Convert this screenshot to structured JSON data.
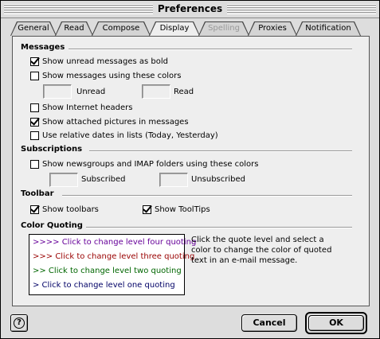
{
  "window": {
    "title": "Preferences"
  },
  "tabs": [
    {
      "label": "General",
      "active": false,
      "disabled": false
    },
    {
      "label": "Read",
      "active": false,
      "disabled": false
    },
    {
      "label": "Compose",
      "active": false,
      "disabled": false
    },
    {
      "label": "Display",
      "active": true,
      "disabled": false
    },
    {
      "label": "Spelling",
      "active": false,
      "disabled": true
    },
    {
      "label": "Proxies",
      "active": false,
      "disabled": false
    },
    {
      "label": "Notification",
      "active": false,
      "disabled": false
    }
  ],
  "messages": {
    "title": "Messages",
    "show_unread_bold": {
      "label": "Show unread messages as bold",
      "checked": true
    },
    "use_colors": {
      "label": "Show messages using these colors",
      "checked": false
    },
    "unread_label": "Unread",
    "read_label": "Read",
    "show_internet_headers": {
      "label": "Show Internet headers",
      "checked": false
    },
    "show_attached_pictures": {
      "label": "Show attached pictures in messages",
      "checked": true
    },
    "relative_dates": {
      "label": "Use relative dates in lists (Today, Yesterday)",
      "checked": false
    }
  },
  "subscriptions": {
    "title": "Subscriptions",
    "use_colors": {
      "label": "Show newsgroups and IMAP folders using these colors",
      "checked": false
    },
    "subscribed_label": "Subscribed",
    "unsubscribed_label": "Unsubscribed"
  },
  "toolbar": {
    "title": "Toolbar",
    "show_toolbars": {
      "label": "Show toolbars",
      "checked": true
    },
    "show_tooltips": {
      "label": "Show ToolTips",
      "checked": true
    }
  },
  "color_quoting": {
    "title": "Color Quoting",
    "levels": [
      {
        "text": ">>>> Click to change level four quoting",
        "color": "#660099"
      },
      {
        "text": ">>> Click to change level three quoting",
        "color": "#990000"
      },
      {
        "text": ">> Click to change level two quoting",
        "color": "#006600"
      },
      {
        "text": "> Click to change level one quoting",
        "color": "#000066"
      }
    ],
    "help_text": "Click the quote level and select a color to change the color of quoted text in an e-mail message."
  },
  "footer": {
    "help_icon": "question-mark-icon",
    "help_glyph": "?",
    "cancel_label": "Cancel",
    "ok_label": "OK"
  }
}
